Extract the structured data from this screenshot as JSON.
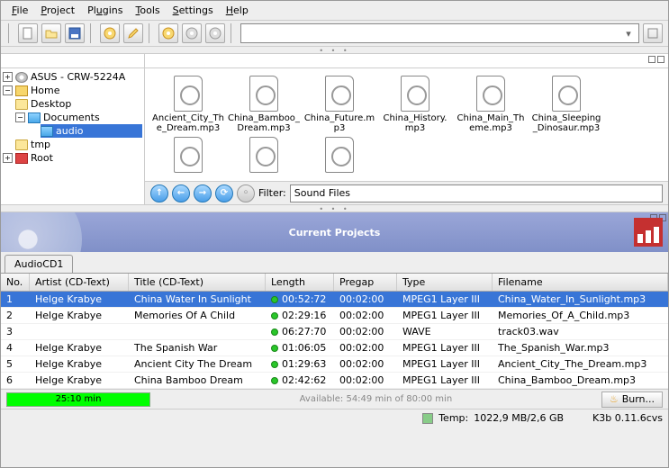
{
  "menu": {
    "file": "File",
    "project": "Project",
    "plugins": "Plugins",
    "tools": "Tools",
    "settings": "Settings",
    "help": "Help"
  },
  "tree": {
    "drive": "ASUS - CRW-5224A",
    "home": "Home",
    "desktop": "Desktop",
    "documents": "Documents",
    "audio": "audio",
    "tmp": "tmp",
    "root": "Root"
  },
  "files": [
    "Ancient_City_The_Dream.mp3",
    "China_Bamboo_Dream.mp3",
    "China_Future.mp3",
    "China_History.mp3",
    "China_Main_Theme.mp3",
    "China_Sleeping_Dinosaur.mp3"
  ],
  "filter": {
    "label": "Filter:",
    "value": "Sound Files"
  },
  "projects_title": "Current Projects",
  "tab": "AudioCD1",
  "columns": {
    "no": "No.",
    "artist": "Artist (CD-Text)",
    "title": "Title (CD-Text)",
    "length": "Length",
    "pregap": "Pregap",
    "type": "Type",
    "filename": "Filename"
  },
  "tracks": [
    {
      "no": "1",
      "artist": "Helge Krabye",
      "title": "China Water In Sunlight",
      "length": "00:52:72",
      "pregap": "00:02:00",
      "type": "MPEG1 Layer III",
      "file": "China_Water_In_Sunlight.mp3",
      "sel": true
    },
    {
      "no": "2",
      "artist": "Helge Krabye",
      "title": "Memories Of A Child",
      "length": "02:29:16",
      "pregap": "00:02:00",
      "type": "MPEG1 Layer III",
      "file": "Memories_Of_A_Child.mp3"
    },
    {
      "no": "3",
      "artist": "",
      "title": "",
      "length": "06:27:70",
      "pregap": "00:02:00",
      "type": "WAVE",
      "file": "track03.wav"
    },
    {
      "no": "4",
      "artist": "Helge Krabye",
      "title": "The Spanish War",
      "length": "01:06:05",
      "pregap": "00:02:00",
      "type": "MPEG1 Layer III",
      "file": "The_Spanish_War.mp3"
    },
    {
      "no": "5",
      "artist": "Helge Krabye",
      "title": "Ancient City The Dream",
      "length": "01:29:63",
      "pregap": "00:02:00",
      "type": "MPEG1 Layer III",
      "file": "Ancient_City_The_Dream.mp3"
    },
    {
      "no": "6",
      "artist": "Helge Krabye",
      "title": "China Bamboo Dream",
      "length": "02:42:62",
      "pregap": "00:02:00",
      "type": "MPEG1 Layer III",
      "file": "China_Bamboo_Dream.mp3"
    }
  ],
  "capacity": {
    "used": "25:10 min",
    "info": "Available: 54:49 min of 80:00 min"
  },
  "burn": "Burn...",
  "status": {
    "temp_label": "Temp:",
    "temp": "1022,9 MB/2,6 GB",
    "app": "K3b 0.11.6cvs"
  }
}
